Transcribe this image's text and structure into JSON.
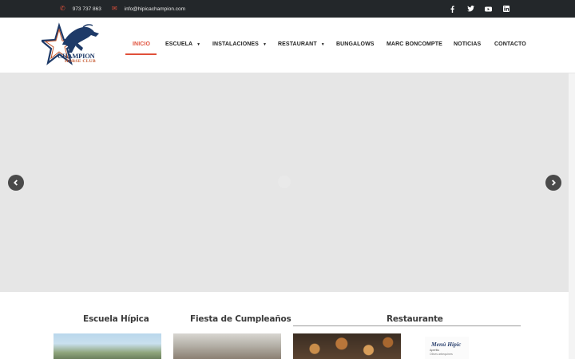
{
  "topbar": {
    "phone_icon": "phone-icon",
    "phone": "973 737 863",
    "mail_icon": "envelope-icon",
    "email": "info@hipicachampion.com",
    "social": [
      "facebook-icon",
      "twitter-icon",
      "youtube-icon",
      "linkedin-icon"
    ]
  },
  "logo": {
    "name": "CHAMPION",
    "tagline": "HORSE CLUB"
  },
  "nav": {
    "items": [
      {
        "label": "INICIO",
        "active": true
      },
      {
        "label": "ESCUELA",
        "dropdown": true
      },
      {
        "label": "INSTALACIONES",
        "dropdown": true
      },
      {
        "label": "RESTAURANT",
        "dropdown": true
      },
      {
        "label": "BUNGALOWS"
      },
      {
        "label": "MARC BONCOMPTE"
      },
      {
        "label": "NOTICIAS"
      },
      {
        "label": "CONTACTO"
      }
    ],
    "caret_icon": "caret-down-icon"
  },
  "slider": {
    "prev_icon": "chevron-left-icon",
    "next_icon": "chevron-right-icon"
  },
  "sections": [
    {
      "title": "Escuela Hípica"
    },
    {
      "title": "Fiesta de Cumpleaños"
    },
    {
      "title": "Restaurante"
    }
  ],
  "menu_preview": {
    "title": "Menú Hípic",
    "line1": "Aperitiu",
    "line2": "Olives arbequines"
  },
  "colors": {
    "accent": "#e0503a",
    "topbar_bg": "#23272a",
    "slider_bg": "#e6e6e6"
  }
}
